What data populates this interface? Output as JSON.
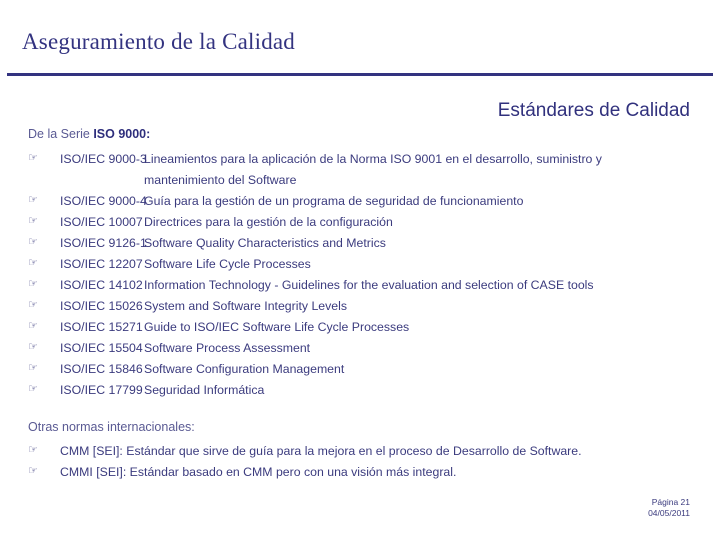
{
  "slide": {
    "title": "Aseguramiento de la Calidad",
    "subtitle": "Estándares de Calidad",
    "accent_color": "#333380",
    "text_color": "#3b3b7e",
    "muted_color": "#5a5a93",
    "bullet_glyph": "☞"
  },
  "section_iso": {
    "heading_plain": "De la Serie ",
    "heading_bold": "ISO 9000:",
    "items": [
      {
        "code": "ISO/IEC 9000-3",
        "desc": "Lineamientos para la aplicación de la Norma ISO 9001 en el desarrollo, suministro y mantenimiento del Software"
      },
      {
        "code": "ISO/IEC 9000-4",
        "desc": "Guía para la gestión de un programa de seguridad de funcionamiento"
      },
      {
        "code": "ISO/IEC 10007",
        "desc": "Directrices para la gestión de la configuración"
      },
      {
        "code": "ISO/IEC 9126-1",
        "desc": "Software Quality Characteristics and Metrics"
      },
      {
        "code": "ISO/IEC 12207",
        "desc": "Software Life Cycle Processes"
      },
      {
        "code": "ISO/IEC 14102",
        "desc": "Information Technology - Guidelines for the evaluation and selection of CASE tools"
      },
      {
        "code": "ISO/IEC 15026",
        "desc": "System and Software Integrity Levels"
      },
      {
        "code": "ISO/IEC 15271",
        "desc": "Guide to ISO/IEC Software Life Cycle Processes"
      },
      {
        "code": "ISO/IEC 15504",
        "desc": "Software Process Assessment"
      },
      {
        "code": "ISO/IEC 15846",
        "desc": "Software Configuration Management"
      },
      {
        "code": "ISO/IEC 17799",
        "desc": "Seguridad Informática"
      }
    ]
  },
  "section_otras": {
    "heading": "Otras normas internacionales:",
    "items": [
      {
        "desc": "CMM [SEI]: Estándar que sirve de guía para la mejora en el proceso de Desarrollo de Software."
      },
      {
        "desc": "CMMI [SEI]: Estándar basado en CMM pero con una visión más integral."
      }
    ]
  },
  "footer": {
    "page": "Página 21",
    "date": "04/05/2011"
  }
}
